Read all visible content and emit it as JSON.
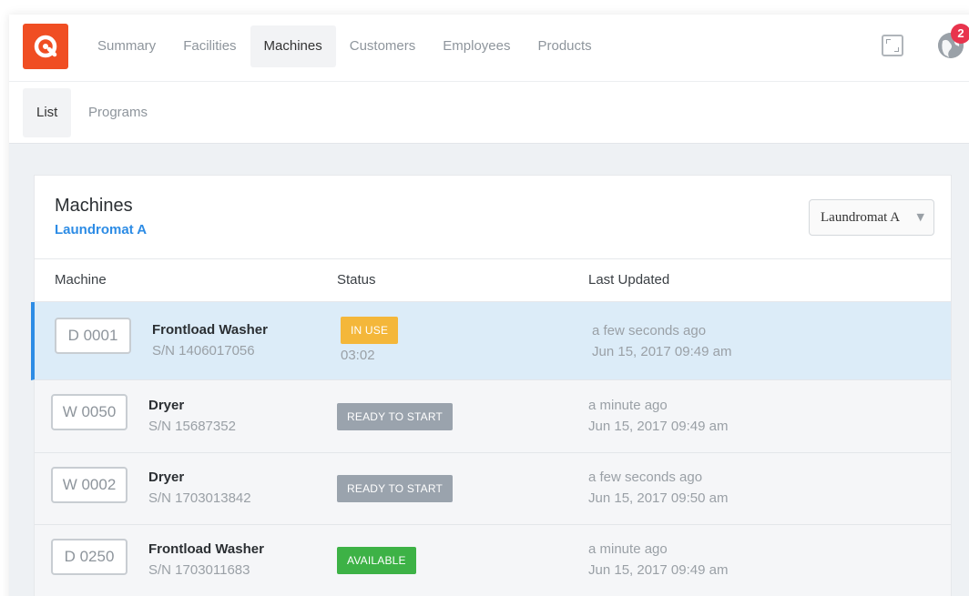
{
  "header": {
    "logo_icon": "q-logo-icon",
    "brand_color": "#f04e23",
    "nav": [
      "Summary",
      "Facilities",
      "Machines",
      "Customers",
      "Employees",
      "Products"
    ],
    "active_nav": "Machines",
    "notification_count": "2"
  },
  "subnav": {
    "items": [
      "List",
      "Programs"
    ],
    "active": "List"
  },
  "panel": {
    "title": "Machines",
    "subtitle": "Laundromat A",
    "location_select": "Laundromat A",
    "columns": [
      "Machine",
      "Status",
      "Last Updated"
    ]
  },
  "machines": [
    {
      "id": "D 0001",
      "name": "Frontload Washer",
      "serial": "S/N 1406017056",
      "status": "IN USE",
      "status_time": "03:02",
      "updated_relative": "a few seconds ago",
      "updated_at": "Jun 15, 2017 09:49 am"
    },
    {
      "id": "W 0050",
      "name": "Dryer",
      "serial": "S/N 15687352",
      "status": "READY TO START",
      "updated_relative": "a minute ago",
      "updated_at": "Jun 15, 2017 09:49 am"
    },
    {
      "id": "W 0002",
      "name": "Dryer",
      "serial": "S/N 1703013842",
      "status": "READY TO START",
      "updated_relative": "a few seconds ago",
      "updated_at": "Jun 15, 2017 09:50 am"
    },
    {
      "id": "D 0250",
      "name": "Frontload Washer",
      "serial": "S/N 1703011683",
      "status": "AVAILABLE",
      "updated_relative": "a minute ago",
      "updated_at": "Jun 15, 2017 09:49 am"
    }
  ],
  "colors": {
    "accent": "#2d8ce5",
    "in_use": "#f4b73a",
    "ready_to_start": "#9aa3ad",
    "available": "#3db246",
    "badge": "#e8344d"
  }
}
